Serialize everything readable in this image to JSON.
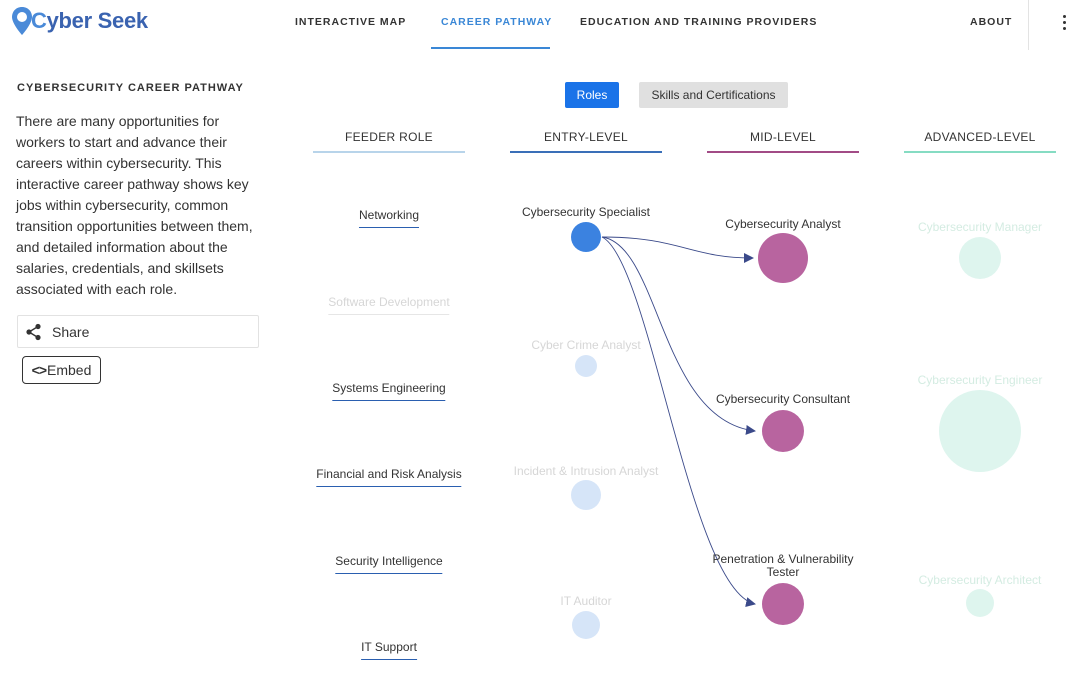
{
  "logo": {
    "text_c": "C",
    "text_rest": "yber Seek"
  },
  "nav": {
    "interactive_map": "INTERACTIVE MAP",
    "career_pathway": "CAREER PATHWAY",
    "education_training": "EDUCATION AND TRAINING PROVIDERS",
    "about": "ABOUT"
  },
  "sidebar": {
    "title": "CYBERSECURITY CAREER PATHWAY",
    "description": "There are many opportunities for workers to start and advance their careers within cybersecurity. This interactive career pathway shows key jobs within cybersecurity, common transition opportunities between them, and detailed information about the salaries, credentials, and skillsets associated with each role.",
    "share_label": "Share",
    "embed_code": "<>",
    "embed_label": "Embed"
  },
  "toggle": {
    "roles": "Roles",
    "skills": "Skills and Certifications"
  },
  "columns": {
    "feeder": "FEEDER ROLE",
    "entry": "ENTRY-LEVEL",
    "mid": "MID-LEVEL",
    "advanced": "ADVANCED-LEVEL"
  },
  "colors": {
    "accent": "#3a87d6",
    "button_blue": "#1a73e8",
    "entry_active": "#3b82e0",
    "entry_dim": "#d6e5f8",
    "mid": "#b8649f",
    "advanced_dim": "#def5ee",
    "feeder_line": "#b8d4ea",
    "entry_line": "#3a6fb8",
    "mid_line": "#a24b86",
    "advanced_line": "#86dcc3",
    "arrow": "#3b4a8a"
  },
  "feeder_roles": [
    {
      "label": "Networking",
      "active": true
    },
    {
      "label": "Software Development",
      "active": false
    },
    {
      "label": "Systems Engineering",
      "active": true
    },
    {
      "label": "Financial and Risk Analysis",
      "active": true
    },
    {
      "label": "Security Intelligence",
      "active": true
    },
    {
      "label": "IT Support",
      "active": true
    }
  ],
  "entry_roles": [
    {
      "label": "Cybersecurity Specialist",
      "active": true
    },
    {
      "label": "Cyber Crime Analyst",
      "active": false
    },
    {
      "label": "Incident & Intrusion Analyst",
      "active": false
    },
    {
      "label": "IT Auditor",
      "active": false
    }
  ],
  "mid_roles": [
    {
      "label": "Cybersecurity Analyst"
    },
    {
      "label": "Cybersecurity Consultant"
    },
    {
      "label_line1": "Penetration & Vulnerability",
      "label_line2": "Tester"
    }
  ],
  "advanced_roles": [
    {
      "label": "Cybersecurity Manager"
    },
    {
      "label": "Cybersecurity Engineer"
    },
    {
      "label": "Cybersecurity Architect"
    }
  ]
}
